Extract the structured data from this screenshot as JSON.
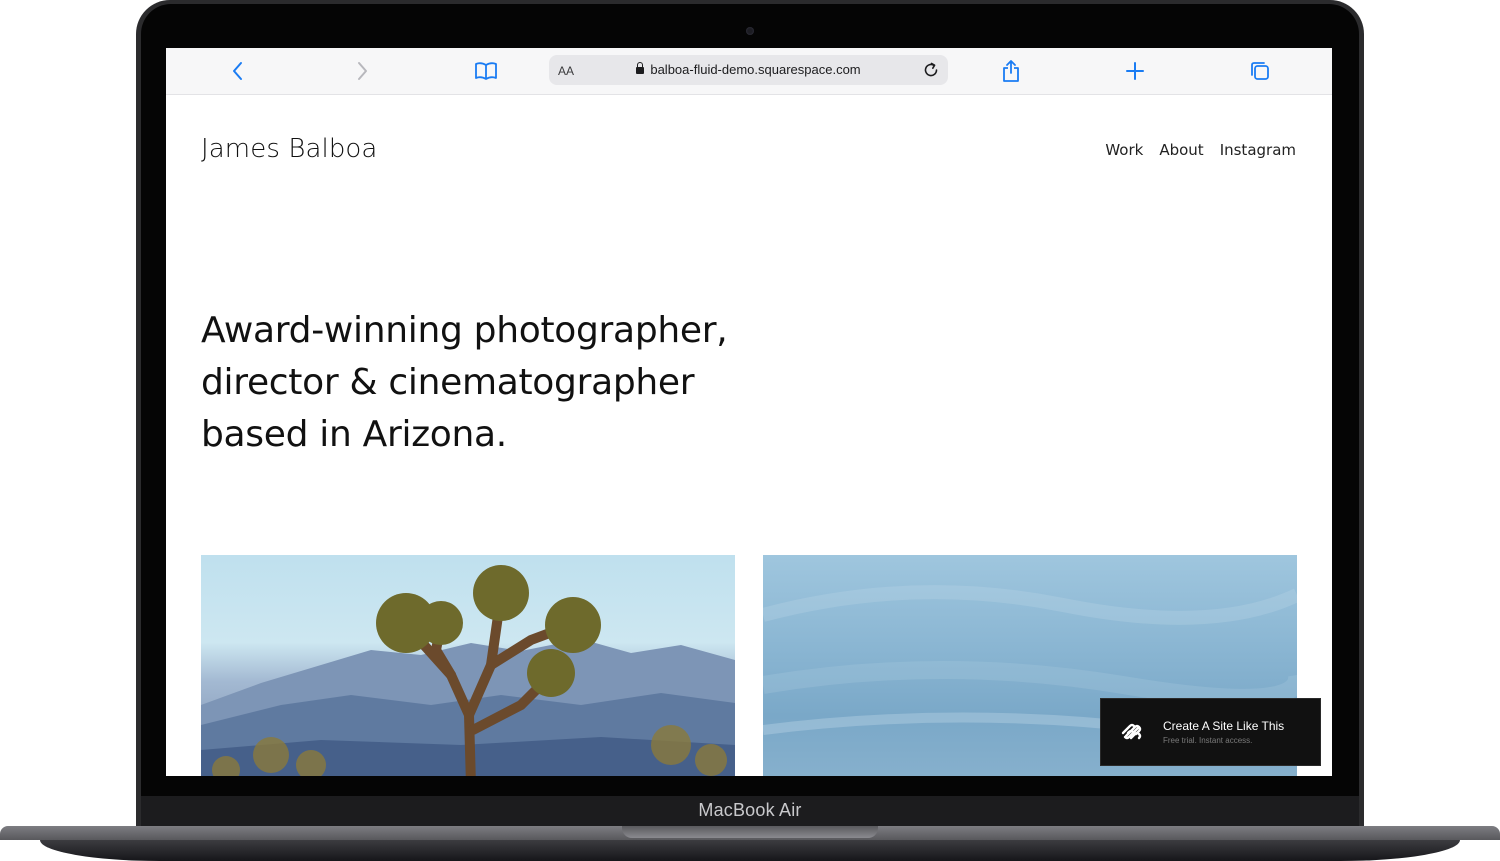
{
  "device": {
    "label": "MacBook Air"
  },
  "browser": {
    "text_size_label": "AA",
    "url": "balboa-fluid-demo.squarespace.com",
    "toolbar_icons": [
      "chevron-left-icon",
      "chevron-right-icon",
      "book-icon",
      "lock-icon",
      "reload-icon",
      "share-icon",
      "plus-icon",
      "tabs-icon"
    ],
    "accent_color": "#1a7cf3"
  },
  "site": {
    "title": "James Balboa",
    "nav": [
      "Work",
      "About",
      "Instagram"
    ],
    "hero_lines": [
      "Award-winning photographer,",
      "director & cinematographer",
      "based in Arizona."
    ]
  },
  "badge": {
    "title": "Create A Site Like This",
    "subtitle": "Free trial. Instant access."
  }
}
